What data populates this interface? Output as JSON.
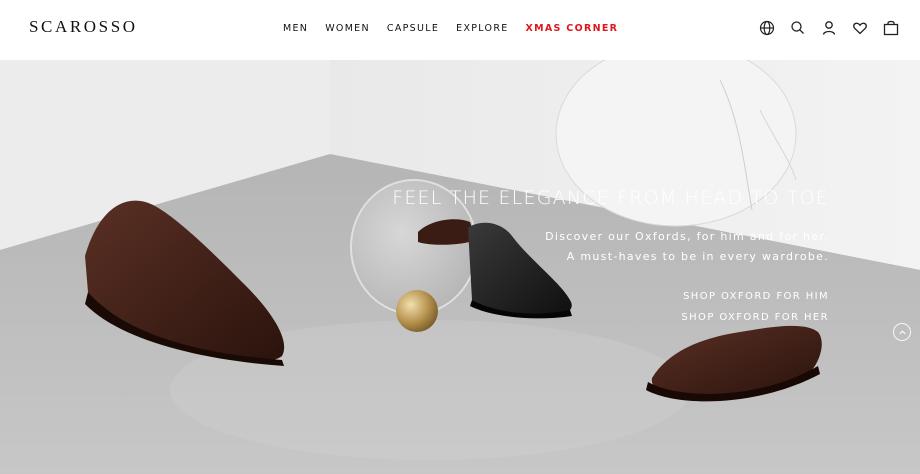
{
  "brand": {
    "name": "SCAROSSO"
  },
  "nav": {
    "items": [
      {
        "label": "MEN"
      },
      {
        "label": "WOMEN"
      },
      {
        "label": "CAPSULE"
      },
      {
        "label": "EXPLORE"
      },
      {
        "label": "XMAS CORNER",
        "color": "#e0161b"
      }
    ]
  },
  "header_icons": [
    "globe-icon",
    "search-icon",
    "account-icon",
    "wishlist-heart-icon",
    "shopping-bag-icon"
  ],
  "hero": {
    "headline": "FEEL THE ELEGANCE FROM HEAD TO TOE",
    "subline_1": "Discover our Oxfords, for him and for her.",
    "subline_2": "A must-haves to be in every wardrobe.",
    "cta_him": "SHOP OXFORD FOR HIM",
    "cta_her": "SHOP OXFORD FOR HER"
  },
  "colors": {
    "accent": "#e0161b",
    "text": "#111111",
    "hero_text": "#ffffff"
  }
}
